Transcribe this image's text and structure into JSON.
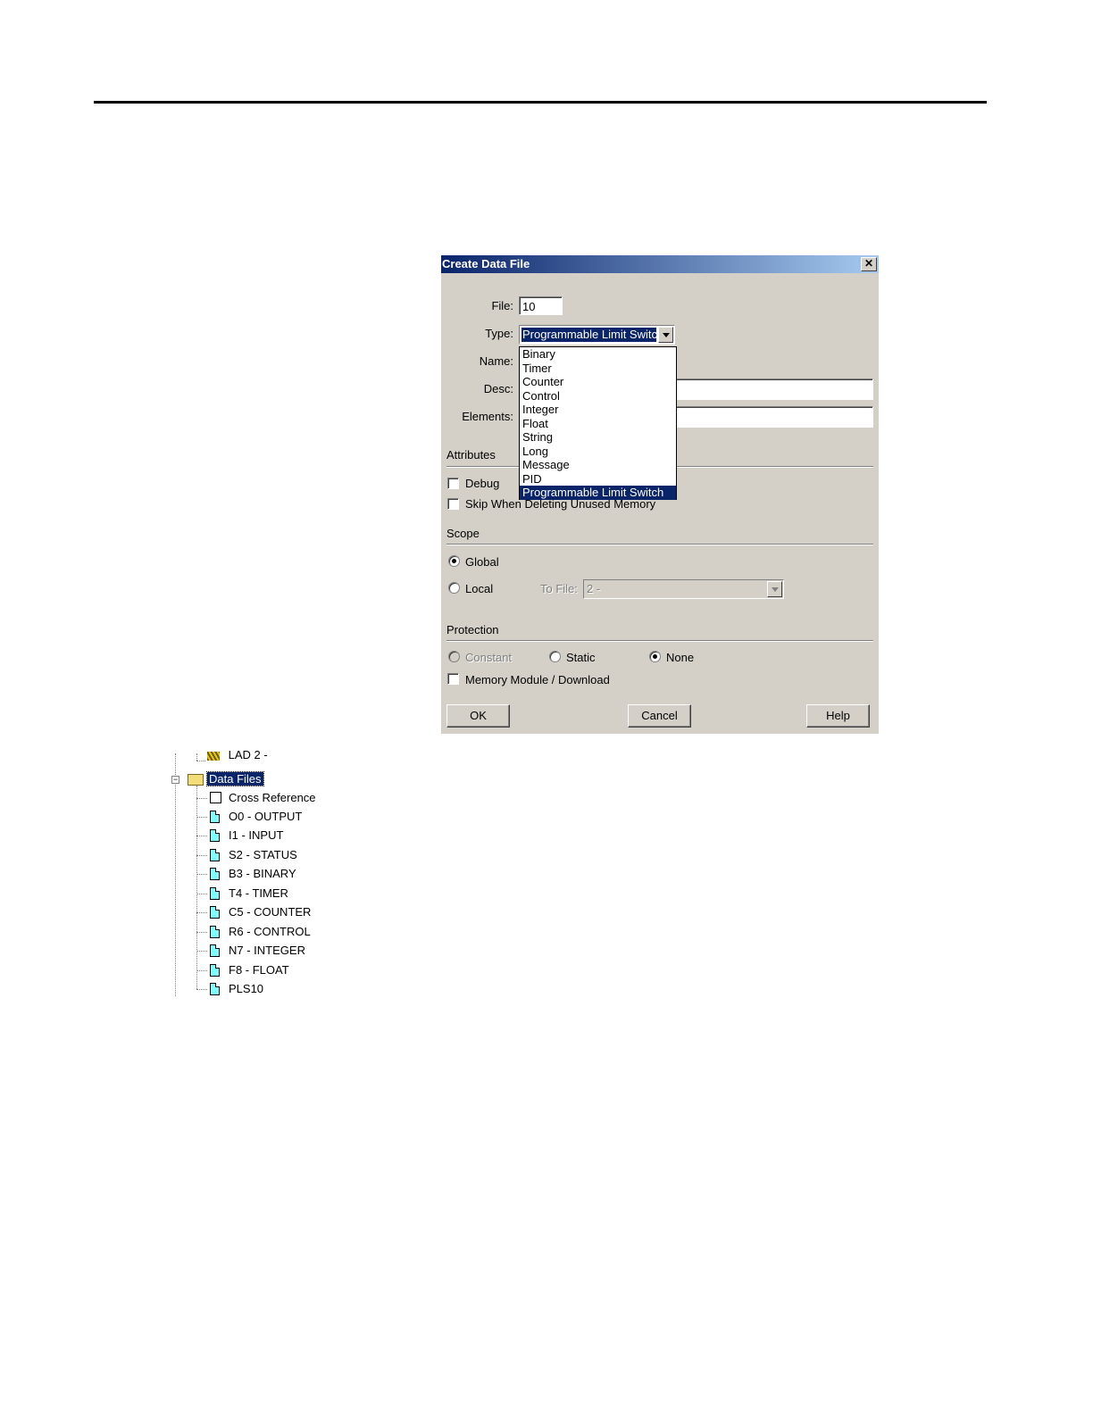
{
  "dialog": {
    "title": "Create Data File",
    "close_label": "✕",
    "file_label": "File:",
    "file_value": "10",
    "type_label": "Type:",
    "type_value": "Programmable Limit Switch",
    "name_label": "Name:",
    "desc_label": "Desc:",
    "elements_label": "Elements:",
    "type_options": [
      "Binary",
      "Timer",
      "Counter",
      "Control",
      "Integer",
      "Float",
      "String",
      "Long",
      "Message",
      "PID",
      "Programmable Limit Switch"
    ],
    "selected_option_index": 10,
    "attributes_label": "Attributes",
    "debug_label": "Debug",
    "skip_label": "Skip When Deleting Unused Memory",
    "scope_label": "Scope",
    "global_label": "Global",
    "local_label": "Local",
    "to_file_label": "To File:",
    "to_file_value": "2 -",
    "scope_selected": "Global",
    "protection_label": "Protection",
    "constant_label": "Constant",
    "static_label": "Static",
    "none_label": "None",
    "protection_selected": "None",
    "memory_module_label": "Memory Module / Download",
    "ok_label": "OK",
    "cancel_label": "Cancel",
    "help_label": "Help"
  },
  "tree": {
    "partial_item": "LAD 2 -",
    "folder_label": "Data Files",
    "expander_symbol": "−",
    "items": [
      "Cross Reference",
      "O0 - OUTPUT",
      "I1 - INPUT",
      "S2 - STATUS",
      "B3 - BINARY",
      "T4 - TIMER",
      "C5 - COUNTER",
      "R6 - CONTROL",
      "N7 - INTEGER",
      "F8 - FLOAT",
      "PLS10"
    ]
  },
  "colors": {
    "dialog_bg": "#d4d0c8",
    "title_start": "#0a246a",
    "title_end": "#a6caf0",
    "selection": "#0a246a",
    "file_icon": "#7fffff"
  }
}
